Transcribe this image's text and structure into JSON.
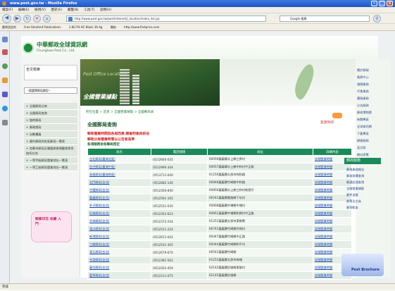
{
  "window": {
    "title": "www.post.gov.tw - Mozilla Firefox"
  },
  "menubar": {
    "items": [
      "檔案(F)",
      "編輯(E)",
      "檢視(V)",
      "歷史(S)",
      "書籤(B)",
      "工具(T)",
      "說明(H)"
    ]
  },
  "navbar": {
    "url": "http://www.post.gov.tw/post/internet/j_location/index_list.jsp",
    "search_placeholder": "Google 搜尋"
  },
  "bookmarks": {
    "items": [
      "最常造訪的",
      "Free Stanford Publications",
      "1.8G P4 HC Black 36 Ag",
      "開始",
      "http://www.findprice.com"
    ]
  },
  "site": {
    "name": "中華郵政全球資訊網",
    "name_en": "Chunghwa Post Co., Ltd."
  },
  "banner": {
    "subtitle": "Post Office Locations",
    "title": "全國營業據點"
  },
  "leftpanel": {
    "header": "全文檢索",
    "select_value": "--請選擇郵局類型--",
    "menu": [
      "+ 全國郵局分佈",
      "+ 全國郵局查詢",
      "+ 臨時郵局",
      "+ 郵政總局",
      "+ 自動櫃員",
      "+ 國內郵政與各區郵局一覽表",
      "+ 各縣市郵局及電腦郵資標籤售票系統所在地",
      "+ 一等甲級郵局營業地址一覽表",
      "+ 一等乙級郵局營業地址一覽表"
    ]
  },
  "promo": {
    "text": "郵資印花 收藏 入門"
  },
  "main": {
    "breadcrumb": "所在位置 > 首頁 > 全國營業據點 > 全國郵局表",
    "title": "全國郵局查詢",
    "notice1": "郵政營業時間因各局而異 請查明後再前往",
    "notice2": "郵政分局營業時間以公告者為準",
    "table_note": "各項服務依各郵局而定",
    "print_link": "友善列印"
  },
  "table": {
    "headers": [
      "局名",
      "電話號碼",
      "局址",
      "詳細內容"
    ],
    "rows": [
      [
        "台北郵局(臺灣北區)",
        "(02)2660-035",
        "60059嘉義縣水上鄉三界村",
        "詳細營業時間"
      ],
      [
        "台中郵局(臺灣中區)",
        "(02)2990-344",
        "60057嘉義縣水上鄉中和村中正路",
        "詳細營業時間"
      ],
      [
        "高雄郵局(臺灣南區)",
        "(05)3711-040",
        "61250嘉義縣太保市祥和路",
        "詳細營業時間"
      ],
      [
        "北門郵局(台北)",
        "(05)2682-140",
        "60848嘉義縣竹崎鄉中和路",
        "詳細營業時間"
      ],
      [
        "中壢郵局(台北)",
        "(05)2356-840",
        "60850嘉義縣水上鄉三和村新厝仔",
        "詳細營業時間"
      ],
      [
        "嘉義郵局(台北)",
        "(05)2591-105",
        "60241嘉義縣番路鄉下坑村",
        "詳細營業時間"
      ],
      [
        "朴子郵局(台北)",
        "(05)2531-030",
        "60668嘉義縣中埔鄉中埔村",
        "詳細營業時間"
      ],
      [
        "民雄郵局(台北)",
        "(05)2352-623",
        "60661嘉義縣中埔鄉和興村中正路",
        "詳細營業時間"
      ],
      [
        "大林郵局(台北)",
        "(05)2372-244",
        "61251嘉義縣太保市東勢寮",
        "詳細營業時間"
      ],
      [
        "溪口郵局(台北)",
        "(05)2521-224",
        "60741嘉義縣竹崎鄉竹崎村",
        "詳細營業時間"
      ],
      [
        "新港郵局(台北)",
        "(05)2611-042",
        "60447嘉義縣竹崎鄉中正路",
        "詳細營業時間"
      ],
      [
        "六腳郵局(台北)",
        "(05)2541-305",
        "60444嘉義縣竹崎鄉和平村",
        "詳細營業時間"
      ],
      [
        "東石郵局(台北)",
        "(05)2679-670",
        "60541嘉義縣竹崎鄉",
        "詳細營業時間"
      ],
      [
        "布袋郵局(台北)",
        "(05)2381-562",
        "61251嘉義縣太保市梅埔",
        "詳細營業時間"
      ],
      [
        "義竹郵局(台北)",
        "(05)2262-459",
        "62142嘉義縣民雄鄉東榮村",
        "詳細營業時間"
      ],
      [
        "鹿草郵局(台北)",
        "(05)2211-075",
        "62145嘉義縣民雄鄉",
        "詳細營業時間"
      ]
    ]
  },
  "rightbar": {
    "top_items": [
      "關於郵政",
      "集郵中心",
      "儲匯業務",
      "代售業務",
      "壽險業務",
      "公告服務",
      "郵政博物館",
      "新聞專區",
      "全球資訊網",
      "下載專區",
      "網路服務",
      "英文版",
      "網站導覽"
    ],
    "section_title": "郵政服務",
    "section_items": [
      "郵政業務報告",
      "郵政資費查詢",
      "郵遞區號查詢",
      "全國營業據點",
      "郵件追蹤",
      "郵票及文具",
      "郵寄範本"
    ]
  },
  "brochure": {
    "label": "Post Brochure"
  },
  "status": {
    "text": "完成"
  }
}
